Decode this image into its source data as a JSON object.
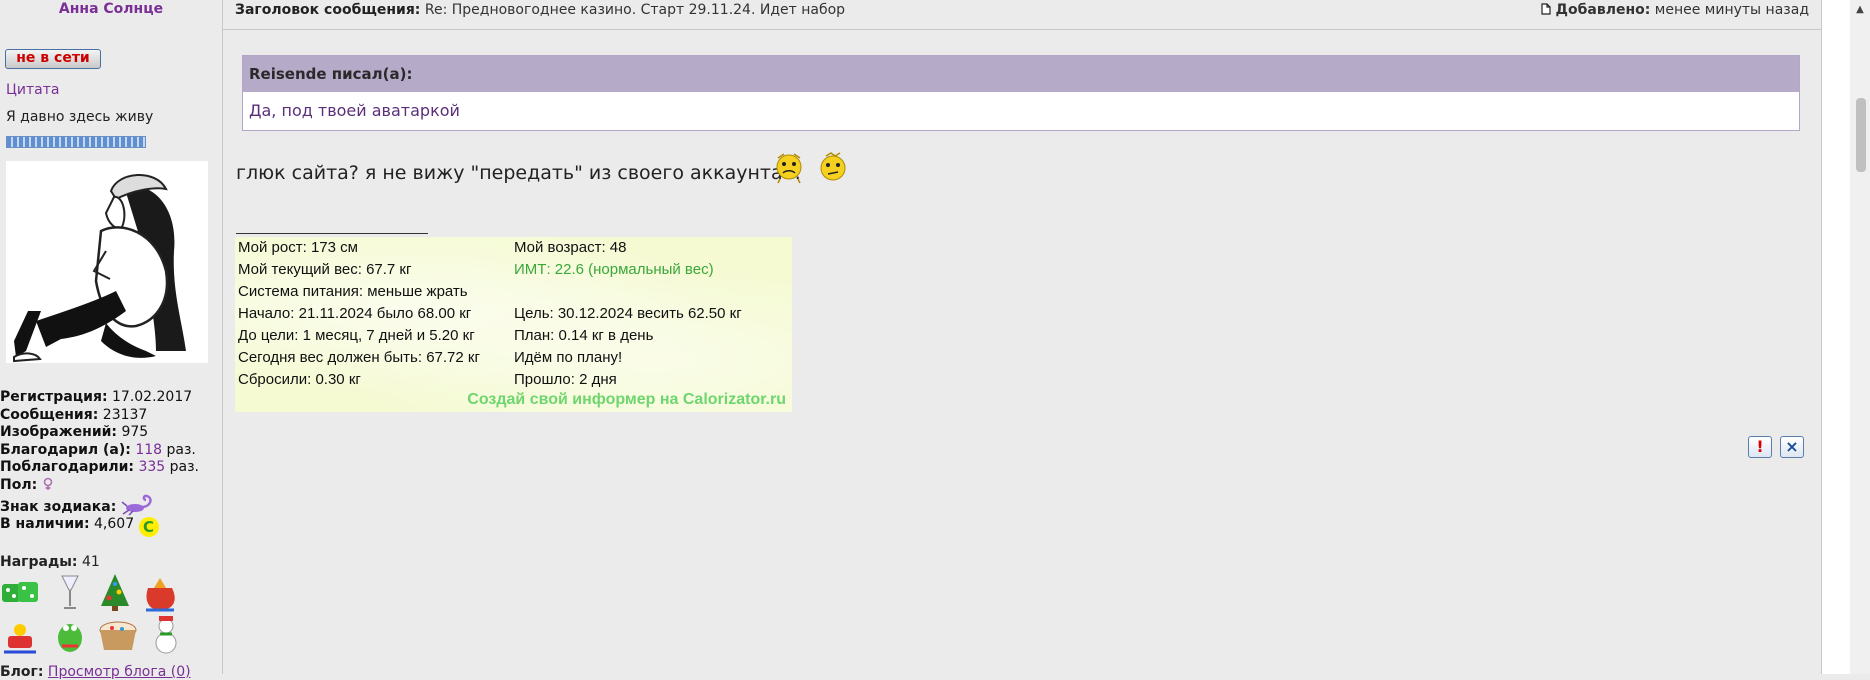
{
  "user": {
    "name": "Анна Солнце",
    "online_status": "не в сети",
    "quote_link": "Цитата",
    "status": "Я давно здесь живу"
  },
  "stats": {
    "reg_label": "Регистрация:",
    "reg_value": "17.02.2017",
    "posts_label": "Сообщения:",
    "posts_value": "23137",
    "images_label": "Изображений:",
    "images_value": "975",
    "thanked_label": "Благодарил (а):",
    "thanked_value": "118",
    "thanked_by_label": "Поблагодарили:",
    "thanked_by_value": "335",
    "times": "раз.",
    "gender_label": "Пол:",
    "zodiac_label": "Знак зодиака:",
    "balance_label": "В наличии:",
    "balance_value": "4,607",
    "coin_letter": "C",
    "awards_label": "Награды:",
    "awards_value": "41",
    "blog_label": "Блог:",
    "blog_link": "Просмотр блога (0)"
  },
  "post": {
    "subject_label": "Заголовок сообщения:",
    "subject": "Re: Предновогоднее казино. Старт 29.11.24. Идет набор",
    "added_label": "Добавлено:",
    "added_value": "менее минуты назад",
    "quote_author": "Reisende писал(а):",
    "quote_text": "Да, под твоей аватаркой",
    "text": "глюк сайта? я не вижу \"передать\" из своего аккаунта..."
  },
  "informer": {
    "height": "Мой рост: 173 см",
    "age": "Мой возраст: 48",
    "weight": "Мой текущий вес: 67.7 кг",
    "bmi": "ИМТ: 22.6 (нормальный вес)",
    "diet": "Система питания: меньше жрать",
    "start": "Начало: 21.11.2024 было 68.00 кг",
    "goal": "Цель: 30.12.2024 весить 62.50 кг",
    "to_goal": "До цели: 1 месяц, 7 дней и 5.20 кг",
    "plan": "План: 0.14 кг в день",
    "today": "Сегодня вес должен быть: 67.72 кг",
    "on_plan": "Идём по плану!",
    "lost": "Сбросили: 0.30 кг",
    "passed": "Прошло: 2 дня",
    "credit": "Создай свой информер на Calorizator.ru"
  },
  "actions": {
    "report": "!",
    "delete": "×"
  },
  "colors": {
    "accent": "#7a2f96",
    "quote_header": "#b6aac9",
    "informer_bg": "#f5fad2",
    "informer_green": "#3aa83a"
  }
}
